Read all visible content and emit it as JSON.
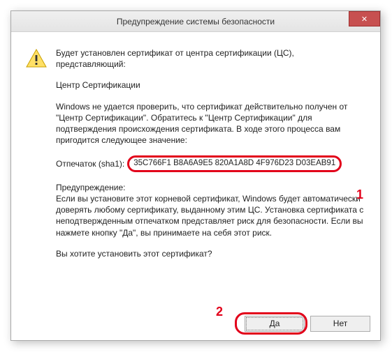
{
  "titlebar": {
    "title": "Предупреждение системы безопасности",
    "close_label": "✕"
  },
  "body": {
    "intro": "Будет установлен сертификат от центра сертификации (ЦС), представляющий:",
    "ca_name": "Центр Сертификации",
    "cannot_verify": "Windows не удается проверить, что сертификат действительно получен от \"Центр Сертификации\". Обратитесь к \"Центр Сертификации\" для подтверждения происхождения сертификата. В ходе этого процесса вам пригодится следующее значение:",
    "thumbprint_label": "Отпечаток (sha1):",
    "thumbprint_value": "35C766F1 B8A6A9E5 820A1A8D 4F976D23 D03EAB91",
    "warning_heading": "Предупреждение:",
    "warning_text": "Если вы установите этот корневой сертификат, Windows будет автоматически доверять любому сертификату, выданному этим ЦС. Установка сертификата с неподтвержденным отпечатком представляет риск для безопасности. Если вы нажмете кнопку \"Да\", вы принимаете на себя этот риск.",
    "question": "Вы хотите установить этот сертификат?"
  },
  "buttons": {
    "yes": "Да",
    "no": "Нет"
  },
  "annotations": {
    "one": "1",
    "two": "2"
  }
}
